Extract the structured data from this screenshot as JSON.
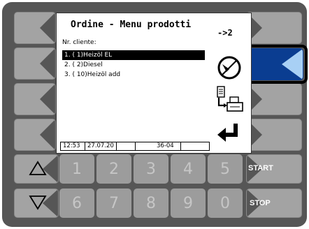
{
  "screen": {
    "title": "Ordine - Menu prodotti",
    "page_indicator": "->2",
    "customer_label": "Nr. cliente:",
    "products": [
      {
        "label": "1.  (  1)Heizöl EL",
        "selected": true
      },
      {
        "label": "2.  (  2)Diesel",
        "selected": false
      },
      {
        "label": "3.  ( 10)Heizöl add",
        "selected": false
      }
    ],
    "status_bar": {
      "time": "12:53",
      "date": "27.07.20",
      "field3": "",
      "code": "36-04",
      "field5": ""
    }
  },
  "side_icons": {
    "right_top": "measurement-dial-icon",
    "right_middle": "print-document-icon",
    "right_bottom": "enter-return-icon"
  },
  "keypad": {
    "row1": [
      "1",
      "2",
      "3",
      "4",
      "5"
    ],
    "row2": [
      "6",
      "7",
      "8",
      "9",
      "0"
    ],
    "up_icon": "triangle-up-icon",
    "down_icon": "triangle-down-icon",
    "start_label": "START",
    "stop_label": "STOP"
  },
  "colors": {
    "bezel": "#565656",
    "key": "#a3a3a3",
    "active_key": "#0a3d91",
    "active_key_arrow": "#a8d0f5"
  }
}
